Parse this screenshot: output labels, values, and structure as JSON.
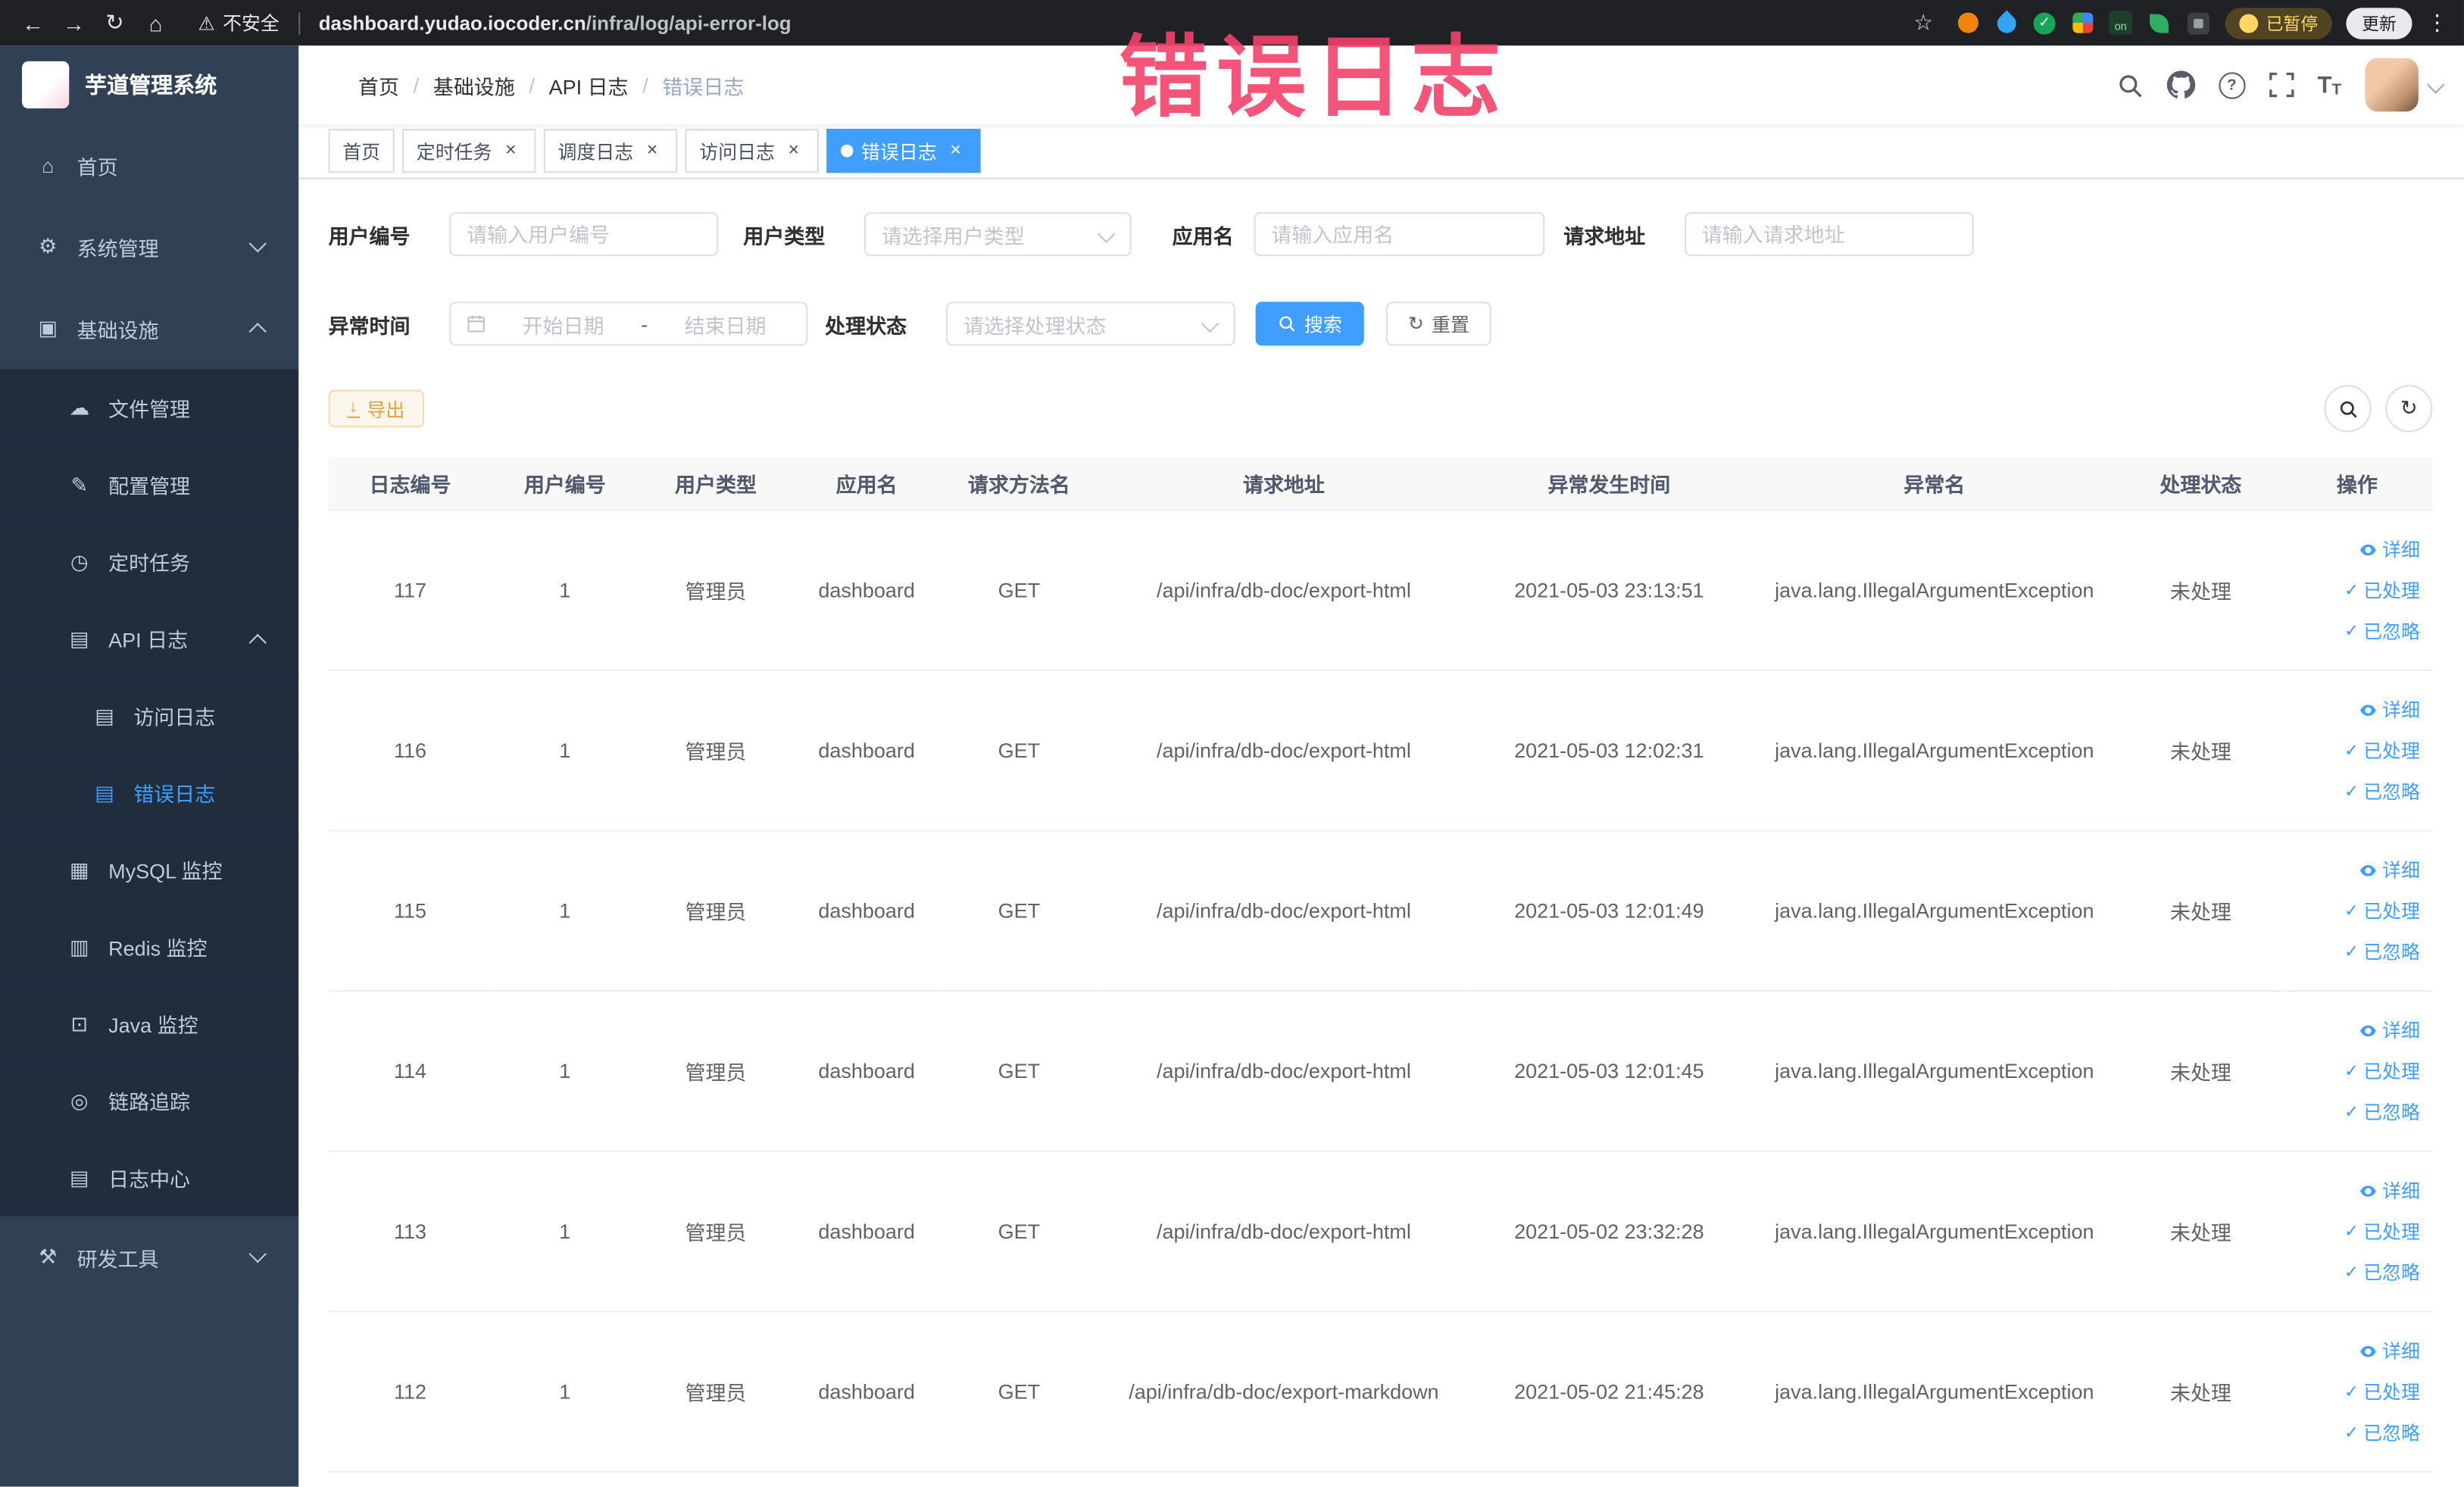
{
  "annotation": {
    "text": "错误日志"
  },
  "browser": {
    "security_label": "不安全",
    "url_domain": "dashboard.yudao.iocoder.cn",
    "url_path": "/infra/log/api-error-log",
    "extension_on_label": "on",
    "paused_badge": "已暂停",
    "update_label": "更新"
  },
  "glyphs": {
    "back": "←",
    "forward": "→",
    "reload": "↻",
    "home": "⌂",
    "warning": "⚠",
    "star": "☆",
    "dots": "⋮",
    "close": "×",
    "check": "✓",
    "breadcrumb_sep": "/",
    "download": "↓",
    "question": "?",
    "font_size_large": "T",
    "font_size_small": "T"
  },
  "sidebar": {
    "logo_title": "芋道管理系统",
    "items": [
      {
        "key": "home",
        "label": "首页",
        "icon": "home-icon",
        "glyph": "⌂",
        "level": 0,
        "arrow": ""
      },
      {
        "key": "system",
        "label": "系统管理",
        "icon": "gear-icon",
        "glyph": "⚙",
        "level": 0,
        "arrow": "down"
      },
      {
        "key": "infra",
        "label": "基础设施",
        "icon": "infrastructure-icon",
        "glyph": "▣",
        "level": 0,
        "arrow": "up"
      },
      {
        "key": "file",
        "label": "文件管理",
        "icon": "file-cloud-icon",
        "glyph": "☁",
        "level": 1,
        "arrow": ""
      },
      {
        "key": "config",
        "label": "配置管理",
        "icon": "edit-icon",
        "glyph": "✎",
        "level": 1,
        "arrow": ""
      },
      {
        "key": "job",
        "label": "定时任务",
        "icon": "timer-icon",
        "glyph": "◷",
        "level": 1,
        "arrow": ""
      },
      {
        "key": "api-log",
        "label": "API 日志",
        "icon": "api-log-icon",
        "glyph": "▤",
        "level": 1,
        "arrow": "up"
      },
      {
        "key": "access-log",
        "label": "访问日志",
        "icon": "access-log-icon",
        "glyph": "▤",
        "level": 2,
        "arrow": ""
      },
      {
        "key": "error-log",
        "label": "错误日志",
        "icon": "error-log-icon",
        "glyph": "▤",
        "level": 2,
        "arrow": "",
        "active": true
      },
      {
        "key": "mysql",
        "label": "MySQL 监控",
        "icon": "mysql-monitor-icon",
        "glyph": "▦",
        "level": 1,
        "arrow": ""
      },
      {
        "key": "redis",
        "label": "Redis 监控",
        "icon": "redis-monitor-icon",
        "glyph": "▥",
        "level": 1,
        "arrow": ""
      },
      {
        "key": "java",
        "label": "Java 监控",
        "icon": "java-monitor-icon",
        "glyph": "⊡",
        "level": 1,
        "arrow": ""
      },
      {
        "key": "tracer",
        "label": "链路追踪",
        "icon": "trace-icon",
        "glyph": "◎",
        "level": 1,
        "arrow": ""
      },
      {
        "key": "log-center",
        "label": "日志中心",
        "icon": "log-center-icon",
        "glyph": "▤",
        "level": 1,
        "arrow": ""
      },
      {
        "key": "dev-tools",
        "label": "研发工具",
        "icon": "tools-icon",
        "glyph": "⚒",
        "level": 0,
        "arrow": "down"
      }
    ]
  },
  "navbar": {
    "breadcrumb": [
      "首页",
      "基础设施",
      "API 日志",
      "错误日志"
    ]
  },
  "tabs": [
    {
      "label": "首页",
      "closable": false,
      "active": false
    },
    {
      "label": "定时任务",
      "closable": true,
      "active": false
    },
    {
      "label": "调度日志",
      "closable": true,
      "active": false
    },
    {
      "label": "访问日志",
      "closable": true,
      "active": false
    },
    {
      "label": "错误日志",
      "closable": true,
      "active": true
    }
  ],
  "filters": {
    "user_id": {
      "label": "用户编号",
      "placeholder": "请输入用户编号"
    },
    "user_type": {
      "label": "用户类型",
      "placeholder": "请选择用户类型"
    },
    "app_name": {
      "label": "应用名",
      "placeholder": "请输入应用名"
    },
    "request_url": {
      "label": "请求地址",
      "placeholder": "请输入请求地址"
    },
    "exception_time": {
      "label": "异常时间",
      "start_placeholder": "开始日期",
      "separator": "-",
      "end_placeholder": "结束日期"
    },
    "process_status": {
      "label": "处理状态",
      "placeholder": "请选择处理状态"
    },
    "search_label": "搜索",
    "reset_label": "重置"
  },
  "toolbar": {
    "export_label": "导出"
  },
  "table": {
    "columns": [
      "日志编号",
      "用户编号",
      "用户类型",
      "应用名",
      "请求方法名",
      "请求地址",
      "异常发生时间",
      "异常名",
      "处理状态",
      "操作"
    ],
    "row_actions": [
      "详细",
      "已处理",
      "已忽略"
    ],
    "rows": [
      {
        "id": "117",
        "user_id": "1",
        "user_type": "管理员",
        "app": "dashboard",
        "method": "GET",
        "url": "/api/infra/db-doc/export-html",
        "time": "2021-05-03 23:13:51",
        "exception": "java.lang.IllegalArgumentException",
        "status": "未处理"
      },
      {
        "id": "116",
        "user_id": "1",
        "user_type": "管理员",
        "app": "dashboard",
        "method": "GET",
        "url": "/api/infra/db-doc/export-html",
        "time": "2021-05-03 12:02:31",
        "exception": "java.lang.IllegalArgumentException",
        "status": "未处理"
      },
      {
        "id": "115",
        "user_id": "1",
        "user_type": "管理员",
        "app": "dashboard",
        "method": "GET",
        "url": "/api/infra/db-doc/export-html",
        "time": "2021-05-03 12:01:49",
        "exception": "java.lang.IllegalArgumentException",
        "status": "未处理"
      },
      {
        "id": "114",
        "user_id": "1",
        "user_type": "管理员",
        "app": "dashboard",
        "method": "GET",
        "url": "/api/infra/db-doc/export-html",
        "time": "2021-05-03 12:01:45",
        "exception": "java.lang.IllegalArgumentException",
        "status": "未处理"
      },
      {
        "id": "113",
        "user_id": "1",
        "user_type": "管理员",
        "app": "dashboard",
        "method": "GET",
        "url": "/api/infra/db-doc/export-html",
        "time": "2021-05-02 23:32:28",
        "exception": "java.lang.IllegalArgumentException",
        "status": "未处理"
      },
      {
        "id": "112",
        "user_id": "1",
        "user_type": "管理员",
        "app": "dashboard",
        "method": "GET",
        "url": "/api/infra/db-doc/export-markdown",
        "time": "2021-05-02 21:45:28",
        "exception": "java.lang.IllegalArgumentException",
        "status": "未处理"
      }
    ]
  },
  "colors": {
    "primary": "#409eff",
    "warning": "#e6a23c",
    "sidebar_bg": "#304156",
    "submenu_bg": "#1f2d3d",
    "annotation": "#f4426b"
  }
}
